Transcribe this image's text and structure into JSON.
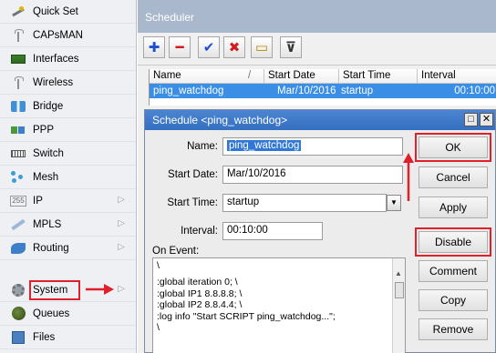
{
  "sidebar": {
    "items": [
      {
        "label": "Quick Set",
        "icon": "wand-icon",
        "submenu": false
      },
      {
        "label": "CAPsMAN",
        "icon": "antenna-icon",
        "submenu": false
      },
      {
        "label": "Interfaces",
        "icon": "ethernet-icon",
        "submenu": false
      },
      {
        "label": "Wireless",
        "icon": "antenna-icon",
        "submenu": false
      },
      {
        "label": "Bridge",
        "icon": "bridge-icon",
        "submenu": false
      },
      {
        "label": "PPP",
        "icon": "ppp-icon",
        "submenu": false
      },
      {
        "label": "Switch",
        "icon": "switch-icon",
        "submenu": false
      },
      {
        "label": "Mesh",
        "icon": "mesh-icon",
        "submenu": false
      },
      {
        "label": "IP",
        "icon": "ip-icon",
        "submenu": true
      },
      {
        "label": "MPLS",
        "icon": "mpls-icon",
        "submenu": true
      },
      {
        "label": "Routing",
        "icon": "routing-icon",
        "submenu": true
      },
      {
        "label": "System",
        "icon": "gear-icon",
        "submenu": true
      },
      {
        "label": "Queues",
        "icon": "queues-icon",
        "submenu": false
      },
      {
        "label": "Files",
        "icon": "files-icon",
        "submenu": false
      }
    ],
    "ip_icon_text": "255",
    "submenu_glyph": "▷"
  },
  "scheduler": {
    "title": "Scheduler",
    "toolbar": {
      "add": "✚",
      "remove": "━",
      "enable": "✔",
      "disable": "✖",
      "comment": "▭",
      "filter": "⊽"
    },
    "columns": {
      "name": "Name",
      "sort_marker": "/",
      "start_date": "Start Date",
      "start_time": "Start Time",
      "interval": "Interval"
    },
    "row": {
      "name": "ping_watchdog",
      "start_date": "Mar/10/2016",
      "start_time": "startup",
      "interval": "00:10:00"
    }
  },
  "dialog": {
    "title": "Schedule <ping_watchdog>",
    "minimize_glyph": "□",
    "close_glyph": "✕",
    "name_label": "Name:",
    "name_value": "ping_watchdog",
    "start_date_label": "Start Date:",
    "start_date_value": "Mar/10/2016",
    "start_time_label": "Start Time:",
    "start_time_value": "startup",
    "start_time_dropdown": "▼",
    "interval_label": "Interval:",
    "interval_value": "00:10:00",
    "on_event_label": "On Event:",
    "on_event_lines": [
      "\\",
      ":global iteration 0; \\",
      ":global IP1 8.8.8.8; \\",
      ":global IP2 8.8.4.4; \\",
      ":log info \"Start SCRIPT ping_watchdog...\";",
      "\\"
    ],
    "scroll_up_glyph": "▲",
    "buttons": {
      "ok": "OK",
      "cancel": "Cancel",
      "apply": "Apply",
      "disable": "Disable",
      "comment": "Comment",
      "copy": "Copy",
      "remove": "Remove"
    }
  },
  "colors": {
    "highlight_red": "#e0202a",
    "selection_blue": "#3b8ee6",
    "dialog_title_blue": "#3a74c6"
  }
}
